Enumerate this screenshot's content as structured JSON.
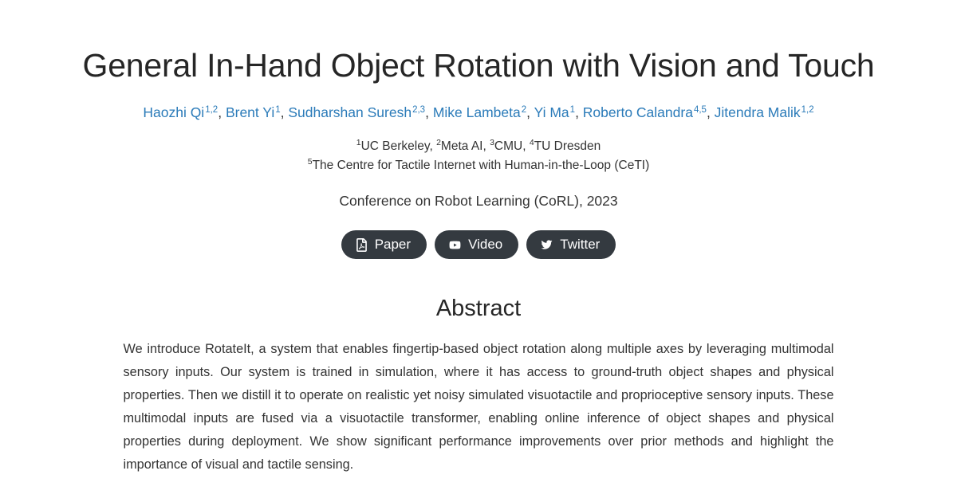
{
  "theme": {
    "background": "#ffffff",
    "text_color": "#333333",
    "heading_color": "#262626",
    "link_color": "#2b7bb9",
    "button_background": "#343a40",
    "button_text": "#ffffff"
  },
  "title": "General In-Hand Object Rotation with Vision and Touch",
  "authors": [
    {
      "name": "Haozhi Qi",
      "superscript": "1,2",
      "separator": ", "
    },
    {
      "name": "Brent Yi",
      "superscript": "1",
      "separator": ", "
    },
    {
      "name": "Sudharshan Suresh",
      "superscript": "2,3",
      "separator": ", "
    },
    {
      "name": "Mike Lambeta",
      "superscript": "2",
      "separator": ", "
    },
    {
      "name": "Yi Ma",
      "superscript": "1",
      "separator": ", "
    },
    {
      "name": "Roberto Calandra",
      "superscript": "4,5",
      "separator": ", "
    },
    {
      "name": "Jitendra Malik",
      "superscript": "1,2",
      "separator": ""
    }
  ],
  "affiliations": {
    "line1": [
      {
        "sup": "1",
        "text": "UC Berkeley, "
      },
      {
        "sup": "2",
        "text": "Meta AI, "
      },
      {
        "sup": "3",
        "text": "CMU, "
      },
      {
        "sup": "4",
        "text": "TU Dresden"
      }
    ],
    "line2": [
      {
        "sup": "5",
        "text": "The Centre for Tactile Internet with Human-in-the-Loop (CeTI)"
      }
    ]
  },
  "venue": "Conference on Robot Learning (CoRL), 2023",
  "buttons": [
    {
      "label": "Paper",
      "icon": "file-pdf-icon"
    },
    {
      "label": "Video",
      "icon": "youtube-play-icon"
    },
    {
      "label": "Twitter",
      "icon": "twitter-bird-icon"
    }
  ],
  "abstract": {
    "heading": "Abstract",
    "text": "We introduce RotateIt, a system that enables fingertip-based object rotation along multiple axes by leveraging multimodal sensory inputs. Our system is trained in simulation, where it has access to ground-truth object shapes and physical properties. Then we distill it to operate on realistic yet noisy simulated visuotactile and proprioceptive sensory inputs. These multimodal inputs are fused via a visuotactile transformer, enabling online inference of object shapes and physical properties during deployment. We show significant performance improvements over prior methods and highlight the importance of visual and tactile sensing."
  }
}
